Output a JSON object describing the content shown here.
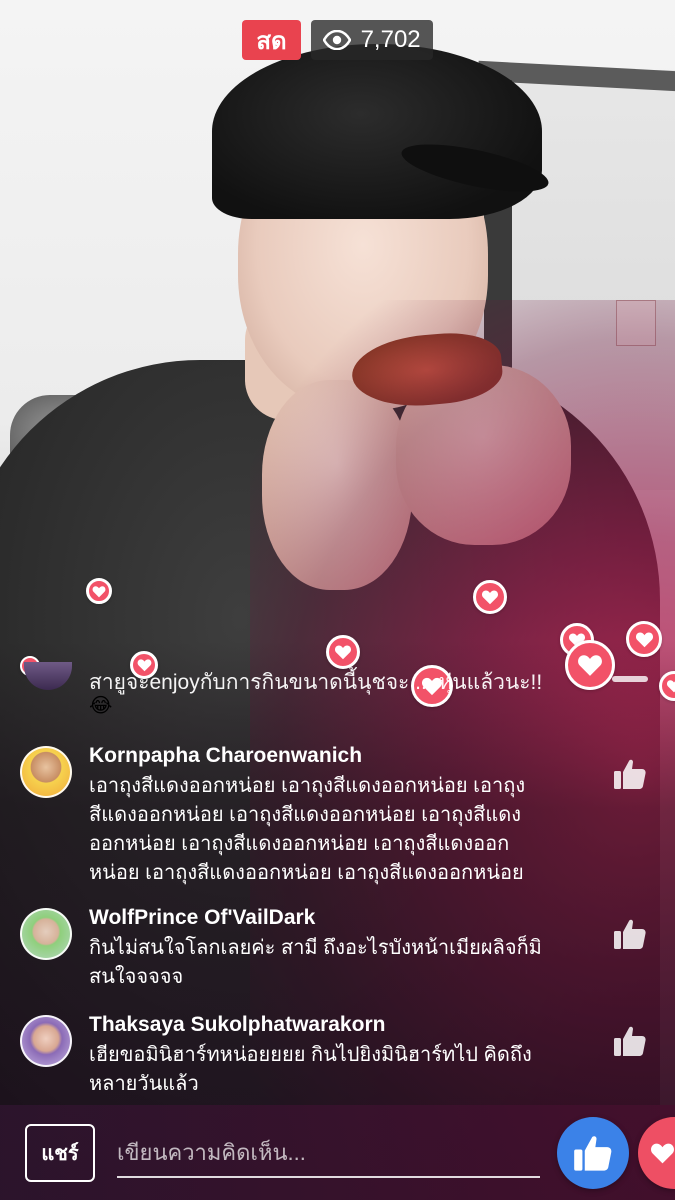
{
  "stream": {
    "live_label": "สด",
    "viewer_count": "7,702"
  },
  "partial_comment": {
    "text": "สายูจะenjoyกับการกินขนาดนี้นุชจะ ... หุ่นแล้วนะ!!"
  },
  "comments": [
    {
      "name": "Kornpapha Charoenwanich",
      "lines": [
        "เอาถุงสีแดงออกหน่อย  เอาถุงสีแดงออกหน่อย  เอาถุง",
        "สีแดงออกหน่อย เอาถุงสีแดงออกหน่อย  เอาถุงสีแดง",
        "ออกหน่อย  เอาถุงสีแดงออกหน่อย เอาถุงสีแดงออก",
        "หน่อย  เอาถุงสีแดงออกหน่อย  เอาถุงสีแดงออกหน่อย"
      ]
    },
    {
      "name": "WolfPrince Of'VailDark",
      "lines": [
        "กินไม่สนใจโลกเลยค่ะ สามี ถึงอะไรบังหน้าเมียผลิจก็มิ",
        "สนใจจจจจ"
      ]
    },
    {
      "name": "Thaksaya Sukolphatwarakorn",
      "lines": [
        "เฮียขอมินิฮาร์ทหน่อยยยย กินไปยิงมินิฮาร์ทไป คิดถึง",
        "หลายวันแล้ว"
      ]
    }
  ],
  "bottom_bar": {
    "share_label": "แชร์",
    "comment_placeholder": "เขียนความคิดเห็น..."
  },
  "colors": {
    "live_badge": "#e9434f",
    "heart": "#f25268",
    "like_button": "#3b82e8"
  }
}
